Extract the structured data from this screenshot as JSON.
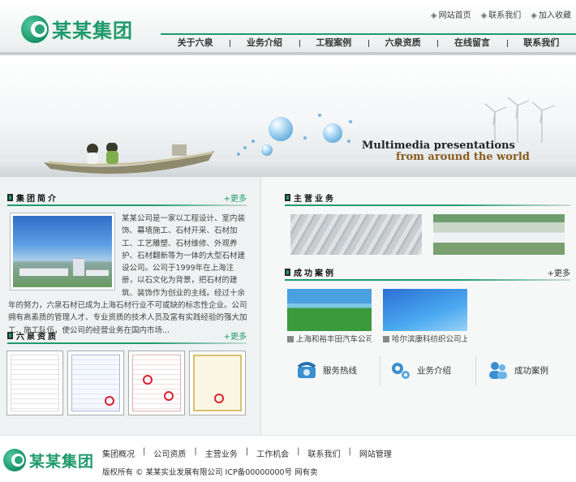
{
  "brand": {
    "name": "某某集团",
    "color": "#1e9a6c"
  },
  "toplinks": [
    {
      "icon": "home-icon",
      "label": "网站首页"
    },
    {
      "icon": "contact-icon",
      "label": "联系我们"
    },
    {
      "icon": "star-icon",
      "label": "加入收藏"
    }
  ],
  "nav": [
    "关于六泉",
    "业务介绍",
    "工程案例",
    "六泉资质",
    "在线留言",
    "联系我们"
  ],
  "banner": {
    "title": "Multimedia presentations",
    "subtitle": "from around the world"
  },
  "intro": {
    "title": "集团简介",
    "more": "更多",
    "text": "某某公司是一家以工程设计、室内装饰、幕墙施工、石材开采、石材加工、工艺雕塑、石材维修、外观养护、石材翻新等为一体的大型石材建设公司。公司于1999年在上海注册，以石文化为背景，把石材的建筑、装饰作为创业的主线。经过十余年的努力，六泉石材已成为上海石材行业不可或缺的标志性企业。公司拥有高素质的管理人才、专业资质的技术人员及富有实践经验的强大加工、施工队伍，使公司的经营业务在国内市场..."
  },
  "qualification": {
    "title": "六泉资质",
    "more": "更多"
  },
  "business": {
    "title": "主营业务"
  },
  "cases": {
    "title": "成功案例",
    "more": "更多",
    "items": [
      {
        "caption": "上海和裕丰田汽车公司..."
      },
      {
        "caption": "哈尔滨康科纺织公司上..."
      }
    ]
  },
  "quick": [
    {
      "icon": "phone-icon",
      "label": "服务热线"
    },
    {
      "icon": "gears-icon",
      "label": "业务介绍"
    },
    {
      "icon": "people-icon",
      "label": "成功案例"
    }
  ],
  "footer": {
    "links": [
      "集团概况",
      "公司资质",
      "主营业务",
      "工作机会",
      "联系我们",
      "网站管理"
    ],
    "copyright": "版权所有 © 某某实业发展有限公司  ICP备00000000号  网有卖"
  }
}
